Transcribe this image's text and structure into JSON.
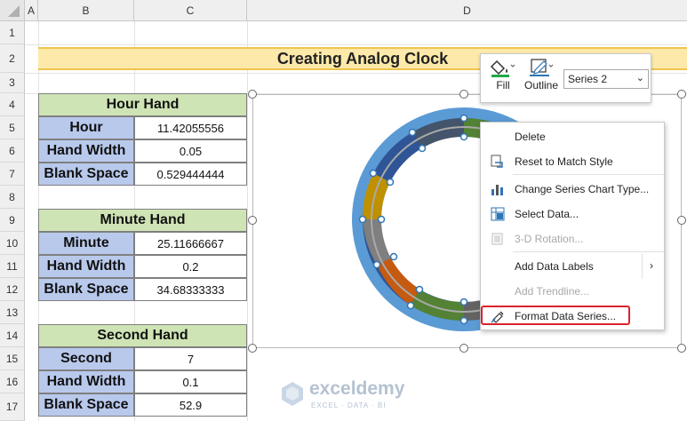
{
  "columns": [
    "A",
    "B",
    "C",
    "D"
  ],
  "rows": [
    "1",
    "2",
    "3",
    "4",
    "5",
    "6",
    "7",
    "8",
    "9",
    "10",
    "11",
    "12",
    "13",
    "14",
    "15",
    "16",
    "17"
  ],
  "title": "Creating Analog Clock",
  "hour_hand": {
    "header": "Hour Hand",
    "rows": [
      {
        "label": "Hour",
        "value": "11.42055556"
      },
      {
        "label": "Hand Width",
        "value": "0.05"
      },
      {
        "label": "Blank Space",
        "value": "0.529444444"
      }
    ]
  },
  "minute_hand": {
    "header": "Minute Hand",
    "rows": [
      {
        "label": "Minute",
        "value": "25.11666667"
      },
      {
        "label": "Hand Width",
        "value": "0.2"
      },
      {
        "label": "Blank Space",
        "value": "34.68333333"
      }
    ]
  },
  "second_hand": {
    "header": "Second Hand",
    "rows": [
      {
        "label": "Second",
        "value": "7"
      },
      {
        "label": "Hand Width",
        "value": "0.1"
      },
      {
        "label": "Blank Space",
        "value": "52.9"
      }
    ]
  },
  "mini_toolbar": {
    "fill_label": "Fill",
    "outline_label": "Outline",
    "series_value": "Series 2"
  },
  "context_menu": {
    "items": [
      {
        "label": "Delete",
        "icon": "none",
        "enabled": true
      },
      {
        "label": "Reset to Match Style",
        "icon": "reset-style-icon",
        "enabled": true
      },
      {
        "label": "Change Series Chart Type...",
        "icon": "chart-type-icon",
        "enabled": true
      },
      {
        "label": "Select Data...",
        "icon": "select-data-icon",
        "enabled": true
      },
      {
        "label": "3-D Rotation...",
        "icon": "3d-rotation-icon",
        "enabled": false
      },
      {
        "label": "Add Data Labels",
        "icon": "none",
        "enabled": true,
        "submenu": true
      },
      {
        "label": "Add Trendline...",
        "icon": "none",
        "enabled": false
      },
      {
        "label": "Format Data Series...",
        "icon": "format-series-icon",
        "enabled": true
      }
    ]
  },
  "watermark": {
    "brand": "exceldemy",
    "tagline": "EXCEL · DATA · BI"
  },
  "colors": {
    "title_fill": "#fde9a9",
    "header_fill": "#cfe4b5",
    "label_fill": "#b8c9ec",
    "outer_ring": "#5b9bd5",
    "highlight": "#d9232e"
  }
}
